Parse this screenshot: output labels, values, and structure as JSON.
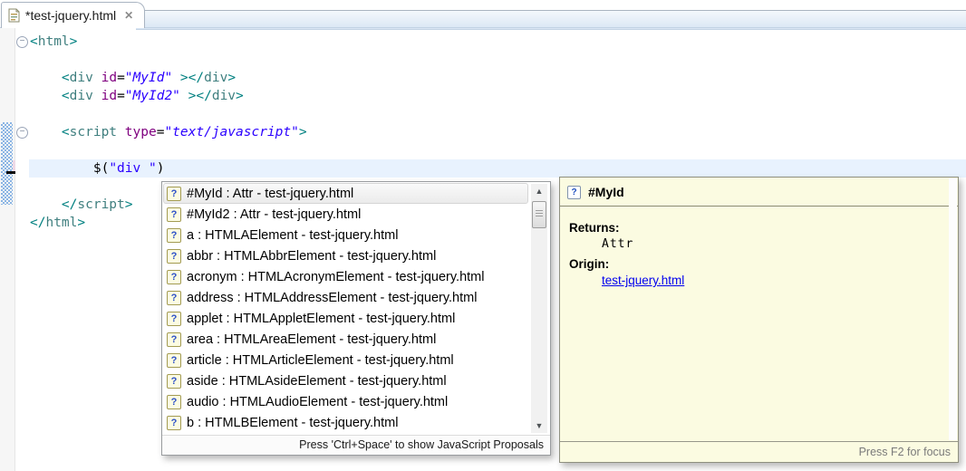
{
  "colors": {
    "tag_name": "#3F7F7F",
    "tag_delimiter": "#008080",
    "attribute_name": "#7F007F",
    "attribute_value": "#2A00FF",
    "string": "#2A00FF",
    "current_line_highlight": "#E8F2FE",
    "quickdiff_added": "#8AB4E4",
    "quickdiff_changed": "#EFD9E6",
    "info_popup_bg": "#FBFBE1",
    "link": "#0000EE"
  },
  "icons": {
    "file_icon": "html-document",
    "close_icon": "✕",
    "fold_collapse_icon": "−",
    "question_icon": "?",
    "scroll_up_icon": "▲",
    "scroll_down_icon": "▼"
  },
  "tab": {
    "title": "*test-jquery.html"
  },
  "editor": {
    "lines": [
      {
        "fold": true,
        "segments": [
          {
            "t": "<",
            "c": "d"
          },
          {
            "t": "html",
            "c": "t"
          },
          {
            "t": ">",
            "c": "d"
          }
        ]
      },
      {
        "segments": []
      },
      {
        "segments": [
          {
            "t": "    ",
            "c": "p"
          },
          {
            "t": "<",
            "c": "d"
          },
          {
            "t": "div",
            "c": "t"
          },
          {
            "t": " ",
            "c": "p"
          },
          {
            "t": "id",
            "c": "a"
          },
          {
            "t": "=",
            "c": "p"
          },
          {
            "t": "\"MyId\"",
            "c": "v"
          },
          {
            "t": " ",
            "c": "p"
          },
          {
            "t": "></",
            "c": "d"
          },
          {
            "t": "div",
            "c": "t"
          },
          {
            "t": ">",
            "c": "d"
          }
        ]
      },
      {
        "segments": [
          {
            "t": "    ",
            "c": "p"
          },
          {
            "t": "<",
            "c": "d"
          },
          {
            "t": "div",
            "c": "t"
          },
          {
            "t": " ",
            "c": "p"
          },
          {
            "t": "id",
            "c": "a"
          },
          {
            "t": "=",
            "c": "p"
          },
          {
            "t": "\"MyId2\"",
            "c": "v"
          },
          {
            "t": " ",
            "c": "p"
          },
          {
            "t": "></",
            "c": "d"
          },
          {
            "t": "div",
            "c": "t"
          },
          {
            "t": ">",
            "c": "d"
          }
        ]
      },
      {
        "segments": []
      },
      {
        "fold": true,
        "segments": [
          {
            "t": "    ",
            "c": "p"
          },
          {
            "t": "<",
            "c": "d"
          },
          {
            "t": "script",
            "c": "t"
          },
          {
            "t": " ",
            "c": "p"
          },
          {
            "t": "type",
            "c": "a"
          },
          {
            "t": "=",
            "c": "p"
          },
          {
            "t": "\"text/javascript\"",
            "c": "v"
          },
          {
            "t": ">",
            "c": "d"
          }
        ]
      },
      {
        "segments": []
      },
      {
        "highlight": true,
        "segments": [
          {
            "t": "        ",
            "c": "p"
          },
          {
            "t": "$(",
            "c": "p"
          },
          {
            "t": "\"div \"",
            "c": "s"
          },
          {
            "t": ")",
            "c": "p"
          }
        ]
      },
      {
        "segments": []
      },
      {
        "segments": [
          {
            "t": "    ",
            "c": "p"
          },
          {
            "t": "</",
            "c": "d"
          },
          {
            "t": "script",
            "c": "t"
          },
          {
            "t": ">",
            "c": "d"
          }
        ]
      },
      {
        "segments": [
          {
            "t": "</",
            "c": "d"
          },
          {
            "t": "html",
            "c": "t"
          },
          {
            "t": ">",
            "c": "d"
          }
        ]
      }
    ]
  },
  "completion": {
    "type_separator": " : ",
    "origin_separator": " - ",
    "items": [
      {
        "name": "#MyId",
        "type": "Attr",
        "origin": "test-jquery.html",
        "selected": true
      },
      {
        "name": "#MyId2",
        "type": "Attr",
        "origin": "test-jquery.html"
      },
      {
        "name": "a",
        "type": "HTMLAElement",
        "origin": "test-jquery.html"
      },
      {
        "name": "abbr",
        "type": "HTMLAbbrElement",
        "origin": "test-jquery.html"
      },
      {
        "name": "acronym",
        "type": "HTMLAcronymElement",
        "origin": "test-jquery.html"
      },
      {
        "name": "address",
        "type": "HTMLAddressElement",
        "origin": "test-jquery.html"
      },
      {
        "name": "applet",
        "type": "HTMLAppletElement",
        "origin": "test-jquery.html"
      },
      {
        "name": "area",
        "type": "HTMLAreaElement",
        "origin": "test-jquery.html"
      },
      {
        "name": "article",
        "type": "HTMLArticleElement",
        "origin": "test-jquery.html"
      },
      {
        "name": "aside",
        "type": "HTMLAsideElement",
        "origin": "test-jquery.html"
      },
      {
        "name": "audio",
        "type": "HTMLAudioElement",
        "origin": "test-jquery.html"
      },
      {
        "name": "b",
        "type": "HTMLBElement",
        "origin": "test-jquery.html"
      }
    ],
    "footer": "Press 'Ctrl+Space' to show JavaScript Proposals"
  },
  "doc": {
    "title": "#MyId",
    "returns_label": "Returns:",
    "returns_value": "Attr",
    "origin_label": "Origin:",
    "origin_link": "test-jquery.html",
    "footer": "Press F2 for focus"
  }
}
